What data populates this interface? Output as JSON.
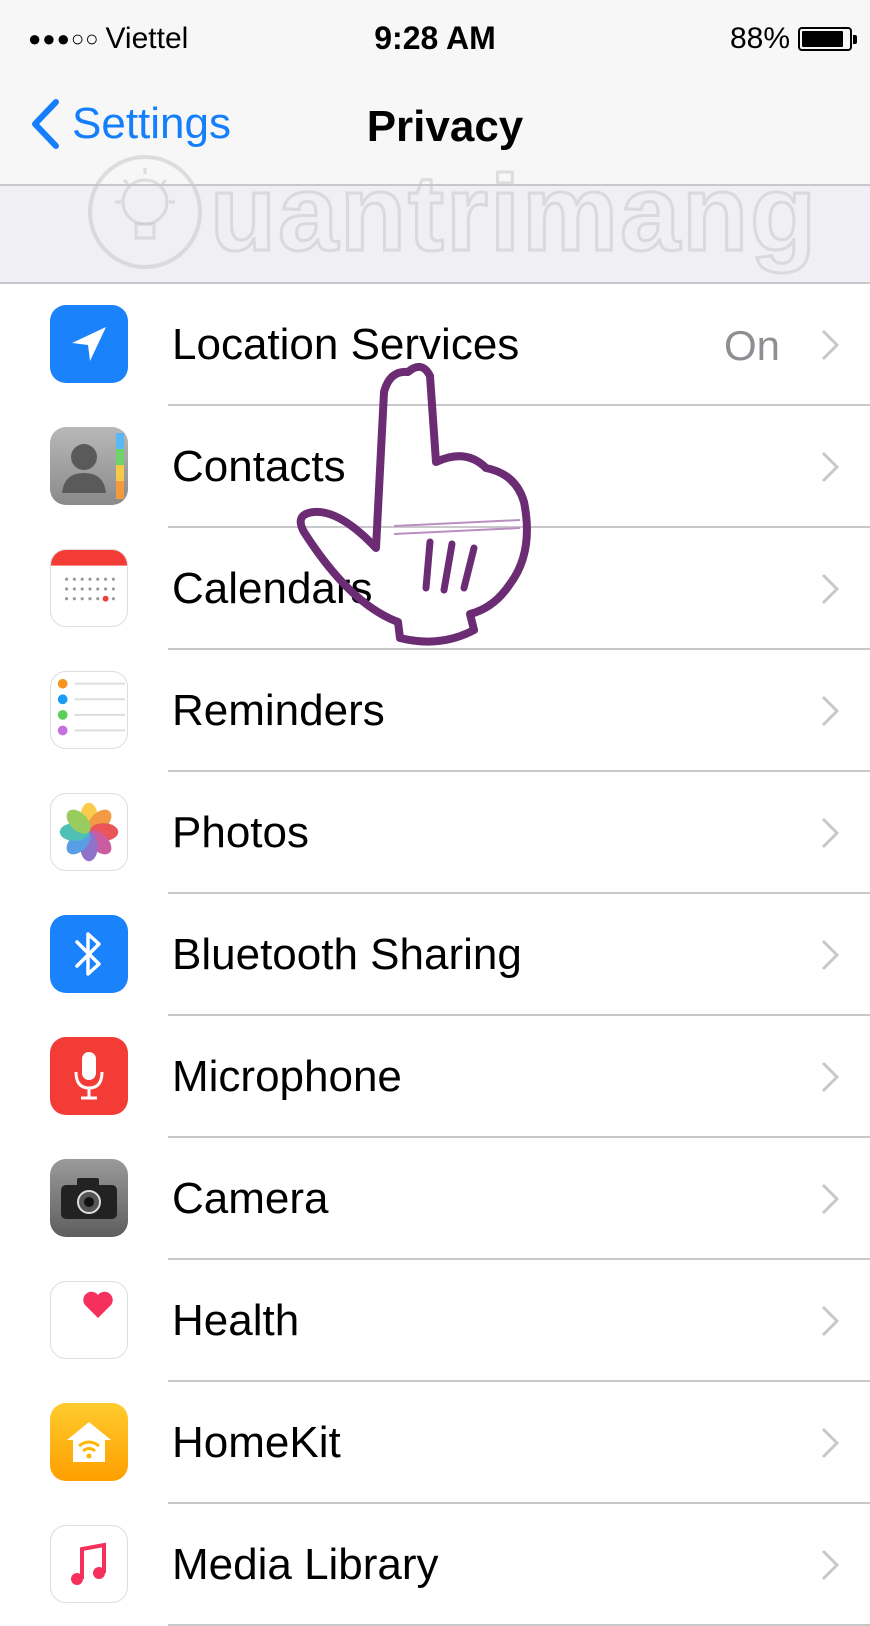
{
  "status_bar": {
    "signal": "●●●○○",
    "carrier": "Viettel",
    "time": "9:28 AM",
    "battery_percent": "88%",
    "battery_level": 0.88
  },
  "nav": {
    "back_label": "Settings",
    "title": "Privacy"
  },
  "watermark": {
    "text": "uantrimang"
  },
  "rows": [
    {
      "label": "Location Services",
      "detail": "On",
      "icon": "location-arrow-icon",
      "color": "#1a82fb"
    },
    {
      "label": "Contacts",
      "detail": "",
      "icon": "contacts-icon",
      "color": "#9a9a9a"
    },
    {
      "label": "Calendars",
      "detail": "",
      "icon": "calendar-icon",
      "color": "#ffffff"
    },
    {
      "label": "Reminders",
      "detail": "",
      "icon": "reminders-icon",
      "color": "#ffffff"
    },
    {
      "label": "Photos",
      "detail": "",
      "icon": "photos-icon",
      "color": "#ffffff"
    },
    {
      "label": "Bluetooth Sharing",
      "detail": "",
      "icon": "bluetooth-icon",
      "color": "#1a82fb"
    },
    {
      "label": "Microphone",
      "detail": "",
      "icon": "microphone-icon",
      "color": "#f33c36"
    },
    {
      "label": "Camera",
      "detail": "",
      "icon": "camera-icon",
      "color": "#777777"
    },
    {
      "label": "Health",
      "detail": "",
      "icon": "health-heart-icon",
      "color": "#ffffff"
    },
    {
      "label": "HomeKit",
      "detail": "",
      "icon": "homekit-icon",
      "color": "#ffb600"
    },
    {
      "label": "Media Library",
      "detail": "",
      "icon": "media-library-icon",
      "color": "#ffffff"
    }
  ]
}
